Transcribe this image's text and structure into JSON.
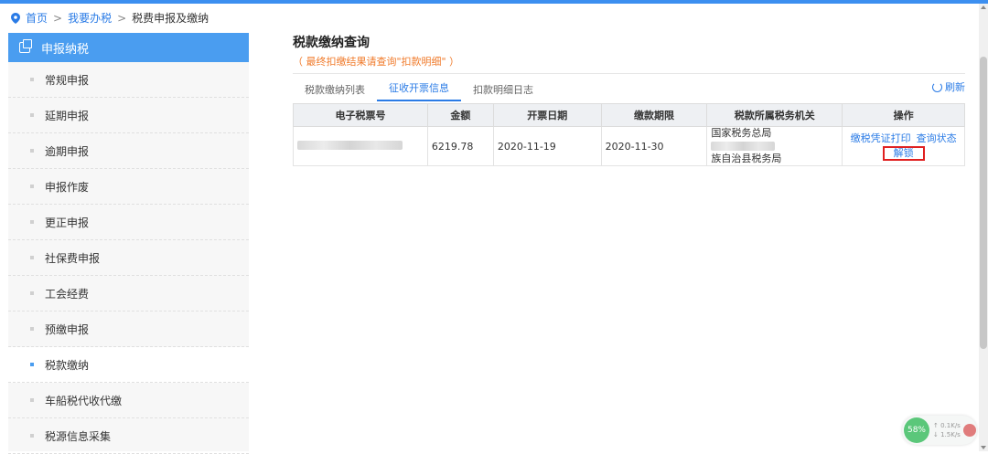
{
  "breadcrumb": {
    "home": "首页",
    "sep": ">",
    "level1": "我要办税",
    "level2": "税费申报及缴纳"
  },
  "sidebar": {
    "header": "申报纳税",
    "items": [
      {
        "label": "常规申报"
      },
      {
        "label": "延期申报"
      },
      {
        "label": "逾期申报"
      },
      {
        "label": "申报作废"
      },
      {
        "label": "更正申报"
      },
      {
        "label": "社保费申报"
      },
      {
        "label": "工会经费"
      },
      {
        "label": "预缴申报"
      },
      {
        "label": "税款缴纳"
      },
      {
        "label": "车船税代收代缴"
      },
      {
        "label": "税源信息采集"
      }
    ],
    "active_index": 8
  },
  "main": {
    "title": "税款缴纳查询",
    "subtitle": "（ 最终扣缴结果请查询\"扣款明细\" ）",
    "tabs": [
      {
        "label": "税款缴纳列表"
      },
      {
        "label": "征收开票信息"
      },
      {
        "label": "扣款明细日志"
      }
    ],
    "active_tab": 1,
    "refresh_label": "刷新",
    "table": {
      "headers": [
        "电子税票号",
        "金额",
        "开票日期",
        "缴款期限",
        "税款所属税务机关",
        "操作"
      ],
      "rows": [
        {
          "amount": "6219.78",
          "issue_date": "2020-11-19",
          "deadline": "2020-11-30",
          "org_line1": "国家税务总局",
          "org_line2": "族自治县税务局",
          "op_print": "缴税凭证打印",
          "op_query": "查询状态",
          "op_unlock": "解锁"
        }
      ]
    }
  },
  "net_widget": {
    "percent": "58%",
    "up": "0.1K/s",
    "down": "1.5K/s"
  },
  "colors": {
    "accent": "#2a7be6",
    "sidebar_header": "#4a9df0",
    "warning": "#f07a2a",
    "highlight_box": "#e02020"
  }
}
